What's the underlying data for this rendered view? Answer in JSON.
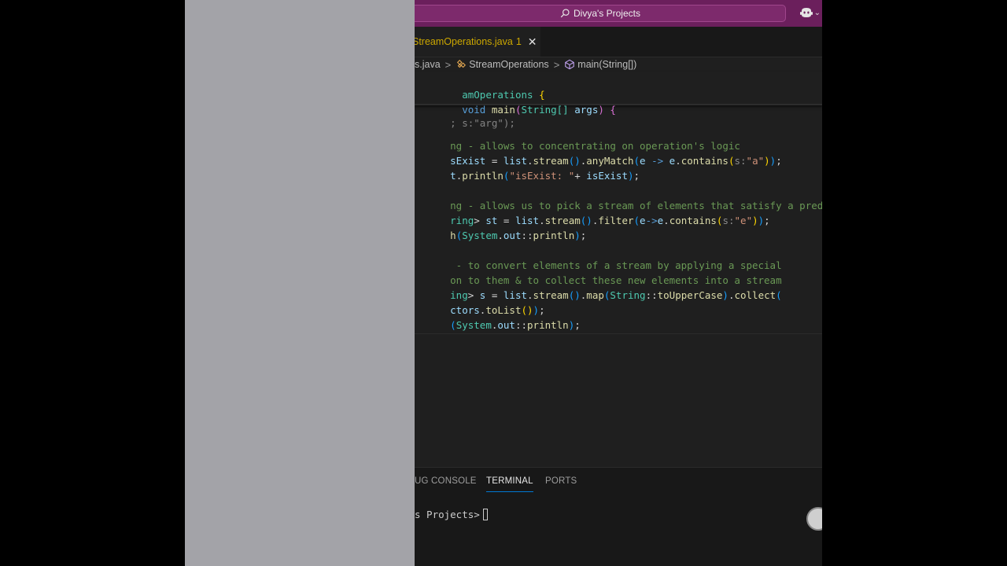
{
  "title_bar": {
    "search_label": "Divya's Projects"
  },
  "tab": {
    "filename": "StreamOperations.java",
    "problem_count": "1",
    "close_glyph": "✕"
  },
  "breadcrumb": {
    "file": "s.java",
    "class": "StreamOperations",
    "method": "main(String[])",
    "separator": ">"
  },
  "code": {
    "sticky_class": "amOperations",
    "sticky_class_brace": "{",
    "sticky_main_kw": "void",
    "sticky_main_fn": "main",
    "sticky_main_params_type": "String[]",
    "sticky_main_params_var": "args",
    "sticky_main_brace": "{",
    "hidden_partial": "; s:\"arg\");",
    "comment1": "ng - allows to concentrating on operation's logic",
    "l2_var": "sExist",
    "l2_eq": " = ",
    "l2_list": "list",
    "l2_dot1": ".",
    "l2_stream": "stream",
    "l2_paren1": "()",
    "l2_dot2": ".",
    "l2_anymatch": "anyMatch",
    "l2_open": "(",
    "l2_e": "e",
    "l2_arrow": " -> ",
    "l2_e2": "e",
    "l2_dot3": ".",
    "l2_contains": "contains",
    "l2_open2": "(",
    "l2_hint": "s:",
    "l2_str": "\"a\"",
    "l2_close2": ")",
    "l2_close": ")",
    "l2_semi": ";",
    "l3_t": "t",
    "l3_dot": ".",
    "l3_println": "println",
    "l3_open": "(",
    "l3_str": "\"isExist: \"",
    "l3_plus": "+ ",
    "l3_var": "isExist",
    "l3_close": ")",
    "l3_semi": ";",
    "comment2": "ng - allows us to pick a stream of elements that satisfy a predicate",
    "l5_type": "ring",
    "l5_gt": "> ",
    "l5_var": "st",
    "l5_eq": " = ",
    "l5_list": "list",
    "l5_dot1": ".",
    "l5_stream": "stream",
    "l5_paren1": "()",
    "l5_dot2": ".",
    "l5_filter": "filter",
    "l5_open": "(",
    "l5_e": "e",
    "l5_arrow": "->",
    "l5_e2": "e",
    "l5_dot3": ".",
    "l5_contains": "contains",
    "l5_open2": "(",
    "l5_hint": "s:",
    "l5_str": "\"e\"",
    "l5_close2": ")",
    "l5_close": ")",
    "l5_semi": ";",
    "l6_h": "h",
    "l6_open": "(",
    "l6_system": "System",
    "l6_dot": ".",
    "l6_out": "out",
    "l6_colons": "::",
    "l6_println": "println",
    "l6_close": ")",
    "l6_semi": ";",
    "comment3a": " - to convert elements of a stream by applying a special",
    "comment3b": "on to them & to collect these new elements into a stream",
    "l9_type": "ing",
    "l9_gt": "> ",
    "l9_var": "s",
    "l9_eq": " = ",
    "l9_list": "list",
    "l9_dot1": ".",
    "l9_stream": "stream",
    "l9_paren1": "()",
    "l9_dot2": ".",
    "l9_map": "map",
    "l9_open": "(",
    "l9_string": "String",
    "l9_colons": "::",
    "l9_upper": "toUpperCase",
    "l9_close": ")",
    "l9_dot3": ".",
    "l9_collect": "collect",
    "l9_open2": "(",
    "l10_ctors": "ctors",
    "l10_dot": ".",
    "l10_tolist": "toList",
    "l10_paren": "()",
    "l10_close": ")",
    "l10_semi": ";",
    "l11_open": "(",
    "l11_system": "System",
    "l11_dot": ".",
    "l11_out": "out",
    "l11_colons": "::",
    "l11_println": "println",
    "l11_close": ")",
    "l11_semi": ";"
  },
  "panel": {
    "tabs": [
      "UG CONSOLE",
      "TERMINAL",
      "PORTS"
    ],
    "active_tab": "TERMINAL",
    "terminal_prompt": "s Projects>"
  },
  "colors": {
    "title_bar": "#6b1f5c",
    "editor_bg": "#1f1f1f",
    "left_panel": "#a3a3a8",
    "tab_modified": "#cca700",
    "active_tab_underline": "#0078d4"
  }
}
